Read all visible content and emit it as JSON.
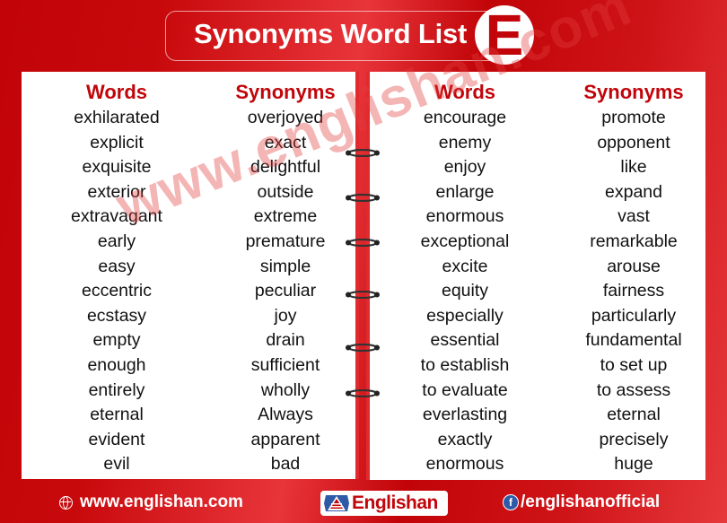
{
  "header": {
    "title": "Synonyms Word List",
    "letter": "E"
  },
  "left_page": {
    "words_header": "Words",
    "synonyms_header": "Synonyms",
    "rows": [
      {
        "word": "exhilarated",
        "synonym": "overjoyed"
      },
      {
        "word": "explicit",
        "synonym": "exact"
      },
      {
        "word": "exquisite",
        "synonym": "delightful"
      },
      {
        "word": "exterior",
        "synonym": "outside"
      },
      {
        "word": "extravagant",
        "synonym": "extreme"
      },
      {
        "word": "early",
        "synonym": "premature"
      },
      {
        "word": "easy",
        "synonym": "simple"
      },
      {
        "word": "eccentric",
        "synonym": "peculiar"
      },
      {
        "word": "ecstasy",
        "synonym": "joy"
      },
      {
        "word": "empty",
        "synonym": "drain"
      },
      {
        "word": "enough",
        "synonym": "sufficient"
      },
      {
        "word": "entirely",
        "synonym": "wholly"
      },
      {
        "word": "eternal",
        "synonym": "Always"
      },
      {
        "word": "evident",
        "synonym": "apparent"
      },
      {
        "word": "evil",
        "synonym": "bad"
      }
    ]
  },
  "right_page": {
    "words_header": "Words",
    "synonyms_header": "Synonyms",
    "rows": [
      {
        "word": "encourage",
        "synonym": "promote"
      },
      {
        "word": "enemy",
        "synonym": "opponent"
      },
      {
        "word": "enjoy",
        "synonym": "like"
      },
      {
        "word": "enlarge",
        "synonym": "expand"
      },
      {
        "word": "enormous",
        "synonym": "vast"
      },
      {
        "word": "exceptional",
        "synonym": "remarkable"
      },
      {
        "word": "excite",
        "synonym": "arouse"
      },
      {
        "word": "equity",
        "synonym": "fairness"
      },
      {
        "word": "especially",
        "synonym": "particularly"
      },
      {
        "word": "essential",
        "synonym": "fundamental"
      },
      {
        "word": "to establish",
        "synonym": "to set up"
      },
      {
        "word": "to evaluate",
        "synonym": "to assess"
      },
      {
        "word": "everlasting",
        "synonym": "eternal"
      },
      {
        "word": "exactly",
        "synonym": "precisely"
      },
      {
        "word": "enormous",
        "synonym": "huge"
      }
    ]
  },
  "watermark": "www.englishan.com",
  "footer": {
    "website": "www.englishan.com",
    "logo_text": "Englishan",
    "social": "/englishanofficial",
    "website_icon": "globe-icon",
    "social_icon": "facebook-icon"
  },
  "colors": {
    "brand_red": "#c1050a",
    "binding_red": "#e02a2e",
    "text": "#111111"
  }
}
